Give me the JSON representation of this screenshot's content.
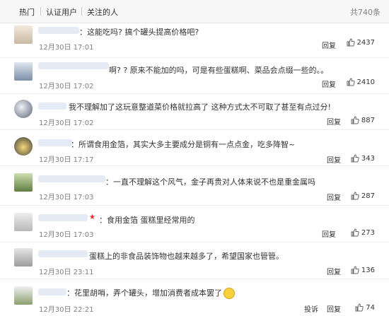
{
  "tabs": {
    "hot": "热门",
    "verified": "认证用户",
    "following": "关注的人"
  },
  "total_count": "共740条",
  "reply_label": "回复",
  "report_label": "投诉",
  "colors": {
    "tab_bg": "#f7f7f7",
    "link": "#333333",
    "muted": "#808080"
  },
  "comments": [
    {
      "text": "：这能吃吗? 搞个罐头提高价格吧?",
      "time": "12月30日 17:01",
      "likes": "2437"
    },
    {
      "text": "啊? ? 原来不能加的吗，可是有些蛋糕啊、菜品会点缀一些的。。",
      "time": "12月30日 17:02",
      "likes": "2410"
    },
    {
      "text": "我不理解加了这玩意整道菜价格就拉高了 这种方式太不可取了甚至有点过分!",
      "time": "12月30日 17:02",
      "likes": "887"
    },
    {
      "text": "：所谓食用金箔，其实大多主要成分是铜有一点点金，吃多降智~",
      "time": "12月30日 17:17",
      "likes": "343"
    },
    {
      "text": "：一直不理解这个风气，金子再贵对人体来说不也是重金属吗",
      "time": "12月30日 17:03",
      "likes": "287"
    },
    {
      "text": "：食用金箔 蛋糕里经常用的",
      "time": "12月30日 17:03",
      "likes": "273"
    },
    {
      "text": "蛋糕上的非食品装饰物也越来越多了，希望国家也管管。",
      "time": "12月30日 23:11",
      "likes": "136"
    },
    {
      "text": "：花里胡哨，弄个罐头，增加消费者成本罢了",
      "time": "12月30日 22:21",
      "likes": "74"
    }
  ]
}
